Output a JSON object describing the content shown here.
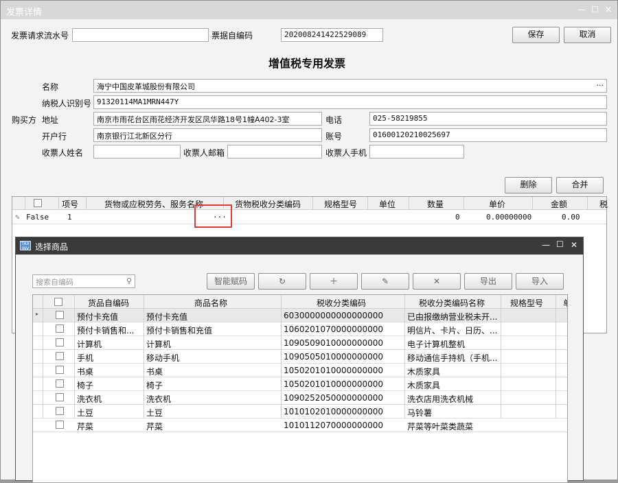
{
  "window": {
    "title": "发票详情"
  },
  "header": {
    "serial_label": "发票请求流水号",
    "serial_value": "",
    "self_code_label": "票据自编码",
    "self_code_value": "202008241422529089",
    "save_label": "保存",
    "cancel_label": "取消",
    "invoice_title": "增值税专用发票"
  },
  "buyer": {
    "section_label": "购买方",
    "name_label": "名称",
    "name_value": "海宁中国皮革城股份有限公司",
    "tax_id_label": "纳税人识别号",
    "tax_id_value": "91320114MA1MRN447Y",
    "address_label": "地址",
    "address_value": "南京市雨花台区雨花经济开发区凤华路18号1幢A402-3室",
    "phone_label": "电话",
    "phone_value": "025-58219855",
    "bank_label": "开户行",
    "bank_value": "南京银行江北新区分行",
    "account_label": "账号",
    "account_value": "01600120210025697",
    "payee_name_label": "收票人姓名",
    "payee_email_label": "收票人邮箱",
    "payee_phone_label": "收票人手机",
    "ellipsis": "···"
  },
  "items": {
    "delete_label": "删除",
    "merge_label": "合并",
    "columns": [
      "项号",
      "货物或应税劳务、服务名称",
      "货物税收分类编码",
      "规格型号",
      "单位",
      "数量",
      "单价",
      "金额",
      "税"
    ],
    "row": {
      "flag": "False",
      "index": "1",
      "ellipsis": "···",
      "quantity": "0",
      "price": "0.00000000",
      "amount": "0.00"
    }
  },
  "dialog": {
    "title": "选择商品",
    "icon_text": "TAX INV",
    "search_placeholder": "搜索自编码",
    "smart_code_label": "智能赋码",
    "export_label": "导出",
    "import_label": "导入",
    "columns": [
      "货品自编码",
      "商品名称",
      "税收分类编码",
      "税收分类编码名称",
      "规格型号",
      "单"
    ],
    "rows": [
      {
        "code": "预付卡充值",
        "name": "预付卡充值",
        "tax_code": "6030000000000000000",
        "tax_name": "已由报缴纳营业税未开..."
      },
      {
        "code": "预付卡销售和...",
        "name": "预付卡销售和充值",
        "tax_code": "1060201070000000000",
        "tax_name": "明信片、卡片、日历、..."
      },
      {
        "code": "计算机",
        "name": "计算机",
        "tax_code": "1090509010000000000",
        "tax_name": "电子计算机整机"
      },
      {
        "code": "手机",
        "name": "移动手机",
        "tax_code": "1090505010000000000",
        "tax_name": "移动通信手持机（手机..."
      },
      {
        "code": "书桌",
        "name": "书桌",
        "tax_code": "1050201010000000000",
        "tax_name": "木质家具"
      },
      {
        "code": "椅子",
        "name": "椅子",
        "tax_code": "1050201010000000000",
        "tax_name": "木质家具"
      },
      {
        "code": "洗衣机",
        "name": "洗衣机",
        "tax_code": "1090252050000000000",
        "tax_name": "洗衣店用洗衣机械"
      },
      {
        "code": "土豆",
        "name": "土豆",
        "tax_code": "1010102010000000000",
        "tax_name": "马铃薯"
      },
      {
        "code": "芹菜",
        "name": "芹菜",
        "tax_code": "1010112070000000000",
        "tax_name": "芹菜等叶菜类蔬菜"
      }
    ]
  }
}
